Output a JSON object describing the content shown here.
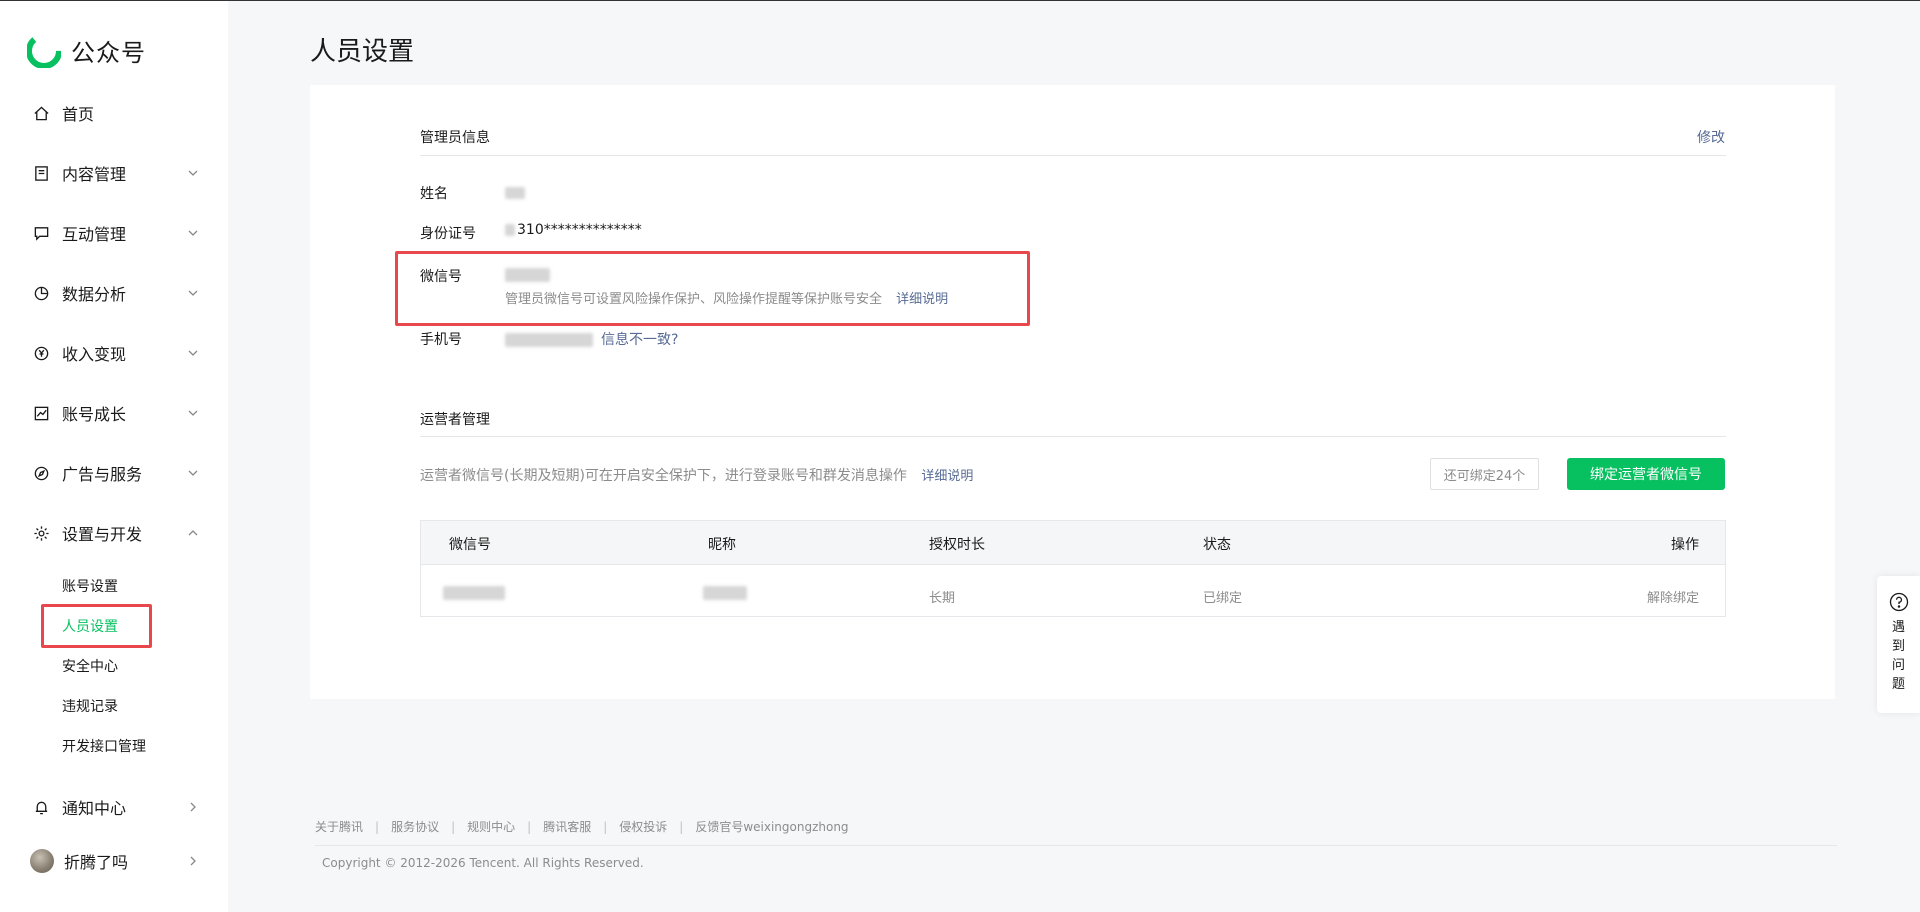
{
  "brand": {
    "name": "公众号"
  },
  "sidebar": {
    "home": "首页",
    "items": [
      {
        "label": "内容管理"
      },
      {
        "label": "互动管理"
      },
      {
        "label": "数据分析"
      },
      {
        "label": "收入变现"
      },
      {
        "label": "账号成长"
      },
      {
        "label": "广告与服务"
      },
      {
        "label": "设置与开发"
      }
    ],
    "sub_items": [
      "账号设置",
      "人员设置",
      "安全中心",
      "违规记录",
      "开发接口管理"
    ],
    "notifications": "通知中心",
    "user": "折腾了吗"
  },
  "page": {
    "title": "人员设置"
  },
  "admin": {
    "section_title": "管理员信息",
    "edit": "修改",
    "name_label": "姓名",
    "id_label": "身份证号",
    "id_value": "310**************",
    "wechat_label": "微信号",
    "wechat_hint": "管理员微信号可设置风险操作保护、风险操作提醒等保护账号安全",
    "wechat_link": "详细说明",
    "phone_label": "手机号",
    "phone_link": "信息不一致?"
  },
  "operators": {
    "section_title": "运营者管理",
    "description": "运营者微信号(长期及短期)可在开启安全保护下，进行登录账号和群发消息操作",
    "link": "详细说明",
    "quota": "还可绑定24个",
    "bind_button": "绑定运营者微信号",
    "columns": [
      "微信号",
      "昵称",
      "授权时长",
      "状态",
      "操作"
    ],
    "rows": [
      {
        "duration": "长期",
        "status": "已绑定",
        "action": "解除绑定"
      }
    ]
  },
  "footer": {
    "links": [
      "关于腾讯",
      "服务协议",
      "规则中心",
      "腾讯客服",
      "侵权投诉",
      "反馈官号weixingongzhong"
    ],
    "copyright": "Copyright © 2012-2026 Tencent. All Rights Reserved."
  },
  "help": {
    "label": "遇到问题"
  },
  "colors": {
    "brand_green": "#07c160",
    "link_blue": "#576b95",
    "highlight_red": "#e8484c"
  }
}
